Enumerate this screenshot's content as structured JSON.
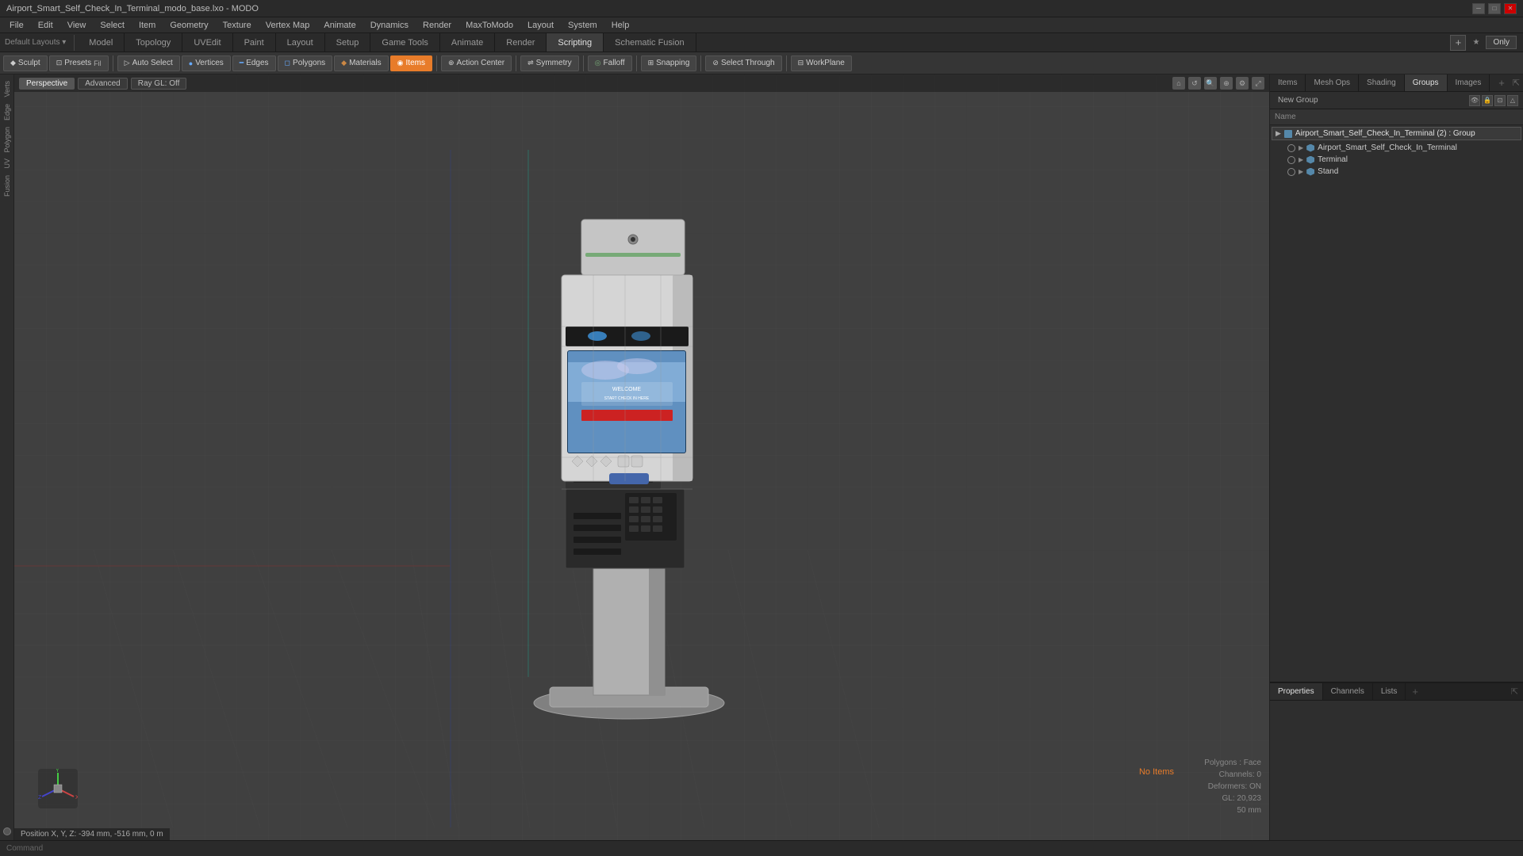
{
  "title_bar": {
    "title": "Airport_Smart_Self_Check_In_Terminal_modo_base.lxo - MODO",
    "min_label": "─",
    "max_label": "□",
    "close_label": "✕"
  },
  "menu_bar": {
    "items": [
      "File",
      "Edit",
      "View",
      "Select",
      "Item",
      "Geometry",
      "Texture",
      "Vertex Map",
      "Animate",
      "Dynamics",
      "Render",
      "MaxToModo",
      "Layout",
      "System",
      "Help"
    ]
  },
  "layout_tabs": {
    "tabs": [
      "Model",
      "Topology",
      "UVEdit",
      "Paint",
      "Layout",
      "Setup",
      "Game Tools",
      "Animate",
      "Render",
      "Scripting",
      "Schematic Fusion"
    ],
    "active": "Model",
    "plus_label": "+",
    "only_label": "Only",
    "star_label": "★"
  },
  "toolbar": {
    "sculpt_label": "Sculpt",
    "presets_label": "Presets",
    "auto_select_label": "Auto Select",
    "vertices_label": "Vertices",
    "edges_label": "Edges",
    "polygons_label": "Polygons",
    "materials_label": "Materials",
    "items_label": "Items",
    "action_center_label": "Action Center",
    "symmetry_label": "Symmetry",
    "falloff_label": "Falloff",
    "snapping_label": "Snapping",
    "select_through_label": "Select Through",
    "workplane_label": "WorkPlane"
  },
  "viewport": {
    "view_label": "Perspective",
    "advanced_label": "Advanced",
    "raygl_label": "Ray GL: Off",
    "status_text": "Position X, Y, Z: -394 mm, -516 mm, 0 m"
  },
  "viewport_stats": {
    "no_items": "No Items",
    "polygons": "Polygons : Face",
    "channels": "Channels: 0",
    "deformers": "Deformers: ON",
    "gl": "GL: 20,923",
    "mm": "50 mm"
  },
  "right_panel": {
    "tabs": [
      "Items",
      "Mesh Ops",
      "Shading",
      "Groups",
      "Images"
    ],
    "active_tab": "Groups",
    "plus_label": "+",
    "new_group_label": "New Group",
    "name_col_label": "Name",
    "group_root_label": "Airport_Smart_Self_Check_In_Terminal (2) : Group",
    "group_items": [
      {
        "label": "Airport_Smart_Self_Check_In_Terminal",
        "type": "mesh"
      },
      {
        "label": "Terminal",
        "type": "mesh"
      },
      {
        "label": "Stand",
        "type": "mesh"
      }
    ]
  },
  "properties_panel": {
    "tabs": [
      "Properties",
      "Channels",
      "Lists"
    ],
    "active_tab": "Properties",
    "plus_label": "+",
    "expand_label": "⇱"
  },
  "command_bar": {
    "label": "Command",
    "placeholder": ""
  }
}
